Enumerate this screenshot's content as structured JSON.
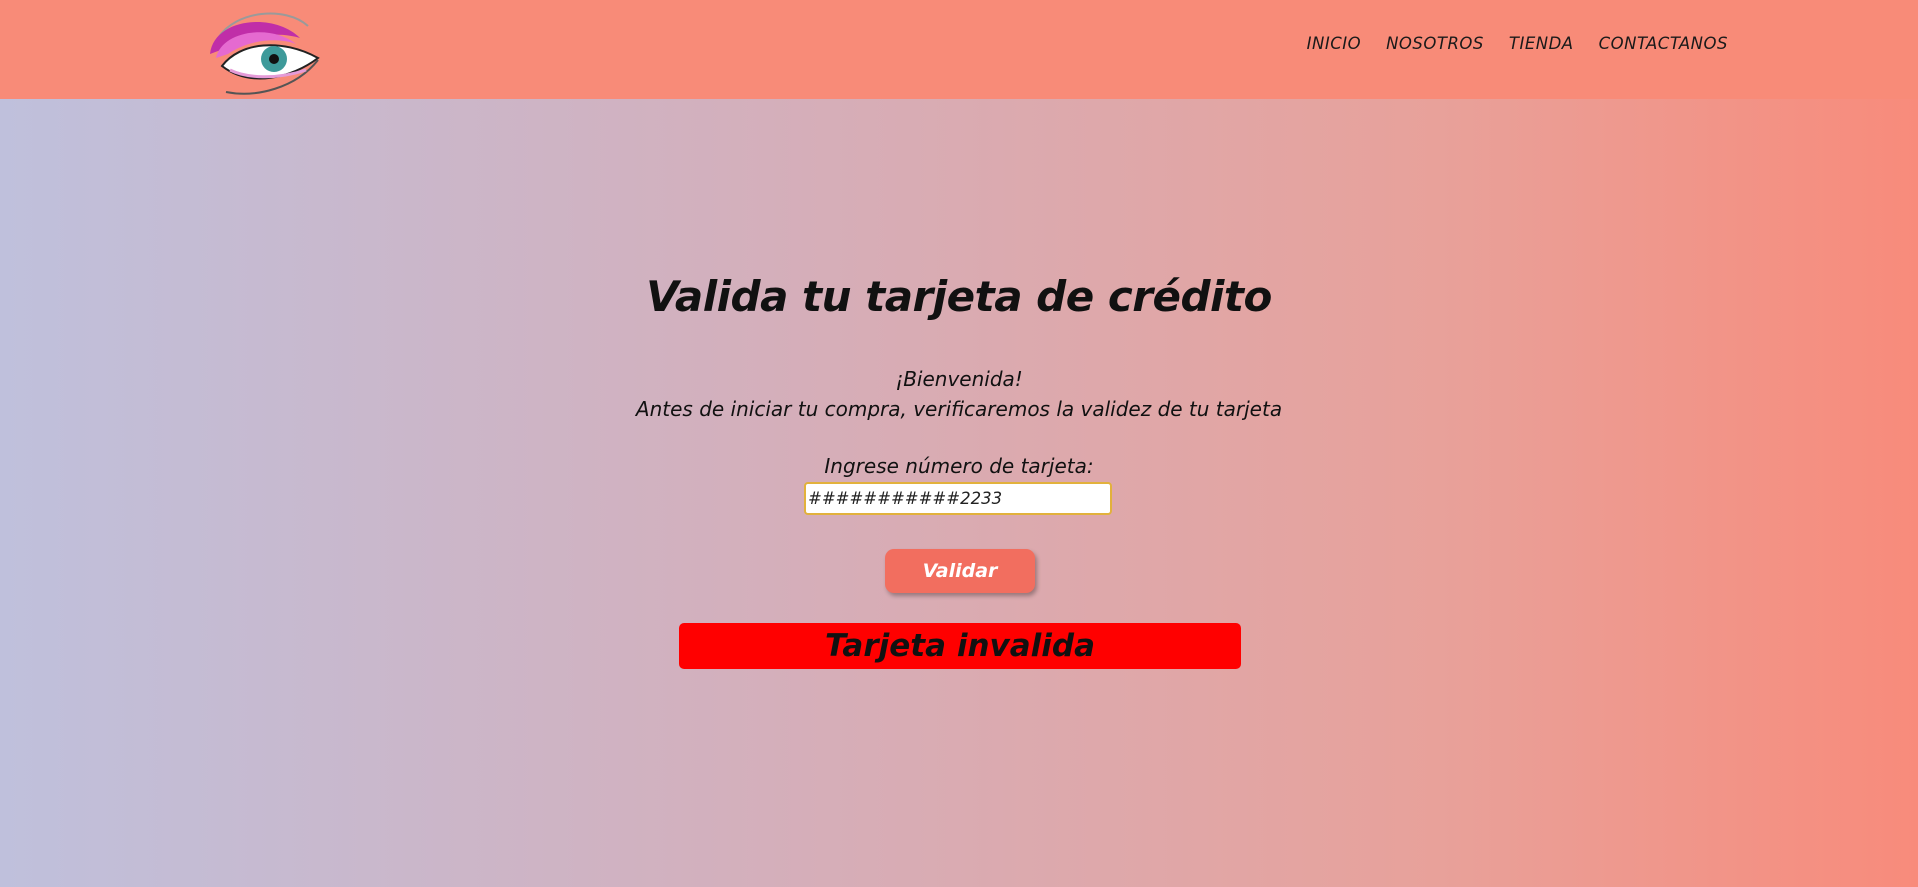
{
  "header": {
    "logo_name": "eye-makeup-logo",
    "nav": [
      "INICIO",
      "NOSOTROS",
      "TIENDA",
      "CONTACTANOS"
    ]
  },
  "main": {
    "title": "Valida tu tarjeta de crédito",
    "welcome": "¡Bienvenida!",
    "subtitle": "Antes de iniciar tu compra, verificaremos la validez de tu tarjeta",
    "card_label": "Ingrese número de tarjeta:",
    "card_value": "###########2233",
    "validate_button": "Validar",
    "result_message": "Tarjeta invalida"
  },
  "colors": {
    "header_bg": "#f88b78",
    "button_bg": "#f26e5f",
    "result_bg": "#ff0000",
    "input_border": "#e2b13c"
  }
}
